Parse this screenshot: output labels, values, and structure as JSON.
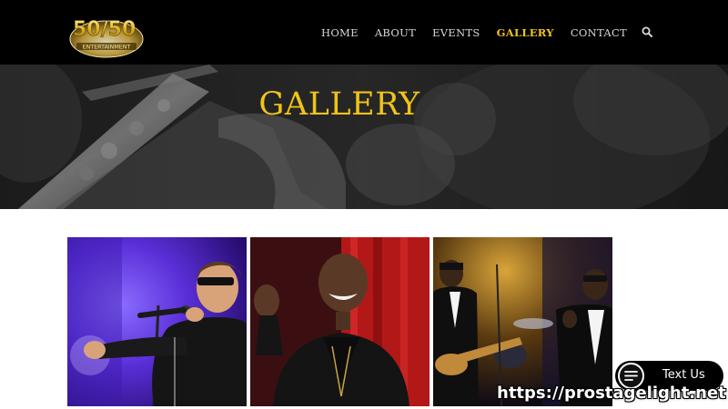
{
  "header": {
    "logo": {
      "top_text": "50/50",
      "sub_text": "ENTERTAINMENT"
    },
    "nav": [
      {
        "label": "HOME"
      },
      {
        "label": "ABOUT"
      },
      {
        "label": "EVENTS"
      },
      {
        "label": "GALLERY",
        "active": true
      },
      {
        "label": "CONTACT"
      }
    ],
    "search_icon": "search-icon",
    "active_color": "#f0c419"
  },
  "hero": {
    "title": "GALLERY",
    "background": "saxophone-photo"
  },
  "gallery": {
    "photos": [
      {
        "subject": "singer-with-sunglasses-on-purple-stage"
      },
      {
        "subject": "smiling-performer-in-leather-jacket-red-curtain"
      },
      {
        "subject": "band-in-tuxedos-on-stage"
      }
    ]
  },
  "text_us": {
    "label": "Text Us",
    "icon": "menu-icon"
  },
  "watermark": "https://prostagelight.net"
}
